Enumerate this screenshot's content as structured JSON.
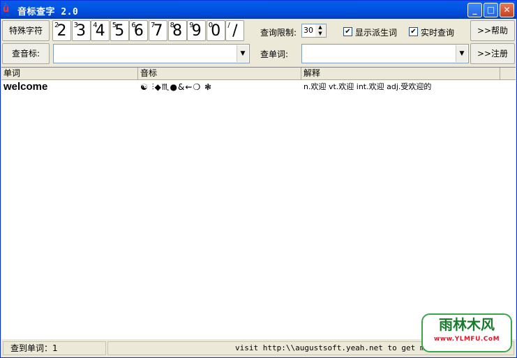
{
  "window": {
    "title": "音标查字 2.0",
    "app_icon": "a-icon",
    "controls": [
      "minimize-icon",
      "maximize-icon",
      "close-icon"
    ]
  },
  "toolbar": {
    "special_chars_label": "特殊字符",
    "keys": [
      {
        "sup": "2",
        "main": "2"
      },
      {
        "sup": "3",
        "main": "3"
      },
      {
        "sup": "4",
        "main": "4"
      },
      {
        "sup": "5",
        "main": "5"
      },
      {
        "sup": "6",
        "main": "6"
      },
      {
        "sup": "7",
        "main": "7"
      },
      {
        "sup": "8",
        "main": "8"
      },
      {
        "sup": "9",
        "main": "9"
      },
      {
        "sup": "0",
        "main": "0"
      },
      {
        "sup": "/",
        "main": "/"
      }
    ],
    "query_limit_label": "查询限制:",
    "query_limit_value": "30",
    "show_derived_label": "显示派生词",
    "show_derived_checked": true,
    "realtime_label": "实时查询",
    "realtime_checked": true,
    "help_button": ">>帮助",
    "search_phonetic_label": "查音标:",
    "search_phonetic_value": "",
    "search_word_label": "查单词:",
    "search_word_value": "",
    "register_button": ">>注册"
  },
  "table": {
    "columns": [
      "单词",
      "音标",
      "解释"
    ],
    "rows": [
      {
        "word": "welcome",
        "phonetic": "☯  ⫶◆♏●&⇜❍   ❃",
        "meaning": "n.欢迎  vt.欢迎  int.欢迎  adj.受欢迎的"
      }
    ]
  },
  "status": {
    "count_label": "查到单词：1",
    "visit_text": "visit http:\\\\augustsoft.yeah.net to get more"
  },
  "watermark": {
    "title": "雨林木风",
    "subtitle": "www.YLMFU.CoM"
  },
  "colors": {
    "titlebar": "#0055e5",
    "window_bg": "#ece9d8",
    "watermark_green": "#1a7a2c"
  }
}
